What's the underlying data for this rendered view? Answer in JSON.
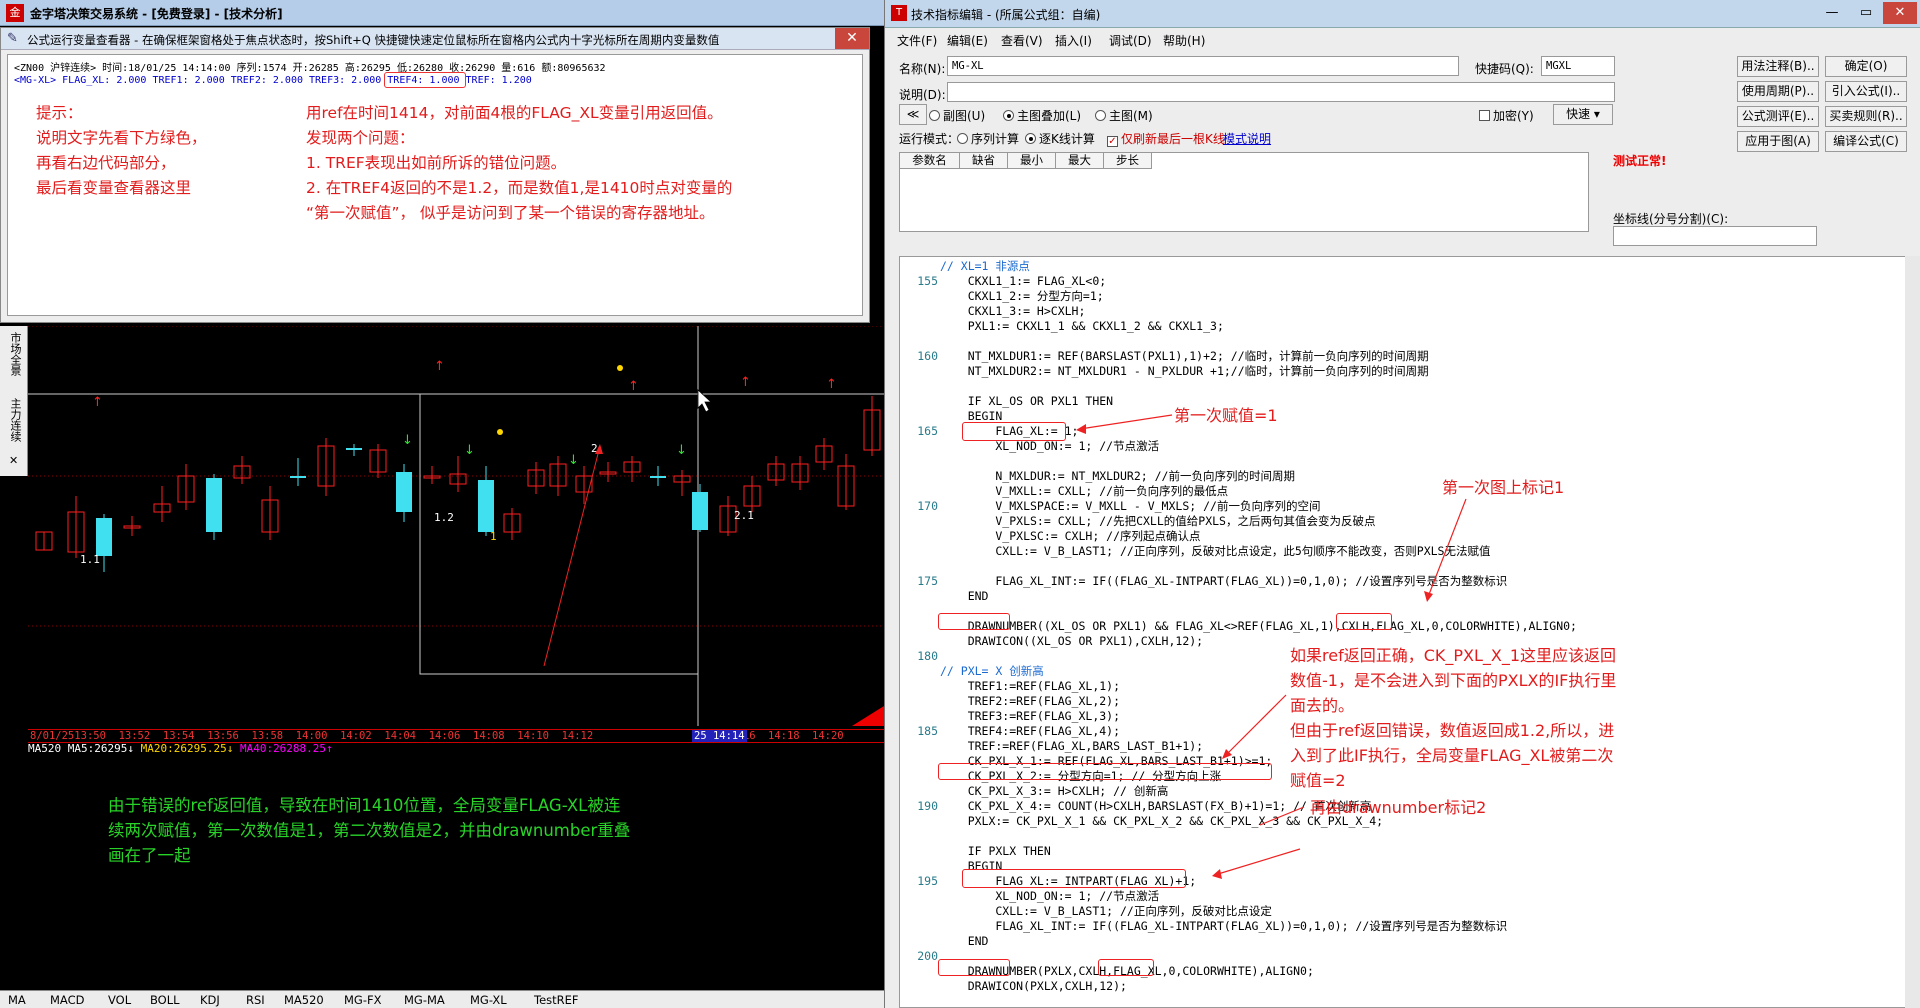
{
  "main_window": {
    "title": "金字塔决策交易系统 - [免费登录] - [技术分析]"
  },
  "viewer": {
    "title": "公式运行变量查看器 - 在确保框架窗格处于焦点状态时，按Shift+Q 快捷键快速定位鼠标所在窗格内公式内十字光标所在周期内变量数值",
    "close": "✕",
    "line1": "<ZN00 沪锌连续> 时间:18/01/25 14:14:00 序列:1574 开:26285 高:26295 低:26280 收:26290 量:616 额:80965632",
    "line2": "<MG-XL> FLAG_XL: 2.000 TREF1: 2.000 TREF2: 2.000 TREF3: 2.000 TREF4: 1.000 TREF: 1.200",
    "hint": [
      "提示：",
      "说明文字先看下方绿色，",
      "再看右边代码部分，",
      "最后看变量查看器这里"
    ],
    "desc": [
      "用ref在时间1414，对前面4根的FLAG_XL变量引用返回值。",
      "发现两个问题：",
      "1.   TREF表现出如前所诉的错位问题。",
      "2.   在TREF4返回的不是1.2，而是数值1,是1410时点对变量的",
      "“第一次赋值”，  似乎是访问到了某一个错误的寄存器地址。"
    ]
  },
  "side_strip": [
    "市场全景",
    "主力连续",
    "✕"
  ],
  "chart": {
    "labels": [
      "1.1",
      "1.2",
      "1",
      "2",
      "2.1"
    ],
    "time_axis": [
      "8/01/25",
      "13:50",
      "13:52",
      "13:54",
      "13:56",
      "13:58",
      "14:00",
      "14:02",
      "14:04",
      "14:06",
      "14:08",
      "14:10",
      "14:12",
      "14:16",
      "14:18",
      "14:20"
    ],
    "current_time": "25 14:14",
    "ma_line": [
      {
        "text": "MA520",
        "color": "#ffffff"
      },
      {
        "text": " MA5:26295↓",
        "color": "#ffffff"
      },
      {
        "text": " MA20:26295.25↓",
        "color": "#ffd700"
      },
      {
        "text": " MA40:26288.25↑",
        "color": "#ff00ff"
      }
    ],
    "note": [
      "由于错误的ref返回值，导致在时间1410位置，全局变量FLAG-XL被连",
      "续两次赋值，第一次数值是1，第二次数值是2，并由drawnumber重叠",
      "画在了一起"
    ]
  },
  "bottom_tabs": [
    "MA",
    "MACD",
    "VOL",
    "BOLL",
    "KDJ",
    "RSI",
    "MA520",
    "MG-FX",
    "MG-MA",
    "MG-XL",
    "TestREF"
  ],
  "editor": {
    "title": "技术指标编辑 - (所属公式组：自编)",
    "menu": [
      "文件(F)",
      "编辑(E)",
      "查看(V)",
      "插入(I)",
      "调试(D)",
      "帮助(H)"
    ],
    "name_label": "名称(N):",
    "name_value": "MG-XL",
    "hotkey_label": "快捷码(Q):",
    "hotkey_value": "MGXL",
    "desc_label": "说明(D):",
    "radio_sub": "副图(U)",
    "radio_main_overlay": "主图叠加(L)",
    "radio_main": "主图(M)",
    "encrypt": "加密(Y)",
    "quick": "快速 ▾",
    "run_mode_label": "运行模式：",
    "run_seq": "序列计算",
    "run_bar": "逐K线计算",
    "only_last": "仅刷新最后一根K线",
    "mode_help": "模式说明",
    "params_headers": [
      "参数名",
      "缺省",
      "最小",
      "最大",
      "步长"
    ],
    "test_ok": "测试正常!",
    "axis_label": "坐标线(分号分割)(C):",
    "buttons": [
      "用法注释(B)..",
      "确定(O)",
      "使用周期(P)..",
      "引入公式(I)..",
      "公式测评(E)..",
      "买卖规则(R)..",
      "应用于图(A)",
      "编译公式(C)"
    ],
    "window_buttons": [
      "—",
      "▭",
      "✕"
    ]
  },
  "code_lines": [
    {
      "n": "",
      "t": "// XL=1 非源点",
      "c": "cm"
    },
    {
      "n": "155",
      "t": "    CKXL1_1:= FLAG_XL<0;"
    },
    {
      "n": "",
      "t": "    CKXL1_2:= 分型方向=1;"
    },
    {
      "n": "",
      "t": "    CKXL1_3:= H>CXLH;"
    },
    {
      "n": "",
      "t": "    PXL1:= CKXL1_1 && CKXL1_2 && CKXL1_3;"
    },
    {
      "n": "",
      "t": ""
    },
    {
      "n": "160",
      "t": "    NT_MXLDUR1:= REF(BARSLAST(PXL1),1)+2; //临时，计算前一负向序列的时间周期"
    },
    {
      "n": "",
      "t": "    NT_MXLDUR2:= NT_MXLDUR1 - N_PXLDUR +1;//临时，计算前一负向序列的时间周期"
    },
    {
      "n": "",
      "t": ""
    },
    {
      "n": "",
      "t": "    IF XL_OS OR PXL1 THEN"
    },
    {
      "n": "",
      "t": "    BEGIN"
    },
    {
      "n": "165",
      "t": "        FLAG_XL:= 1;"
    },
    {
      "n": "",
      "t": "        XL_NOD_ON:= 1; //节点激活"
    },
    {
      "n": "",
      "t": ""
    },
    {
      "n": "",
      "t": "        N_MXLDUR:= NT_MXLDUR2; //前一负向序列的时间周期"
    },
    {
      "n": "",
      "t": "        V_MXLL:= CXLL; //前一负向序列的最低点"
    },
    {
      "n": "170",
      "t": "        V_MXLSPACE:= V_MXLL - V_MXLS; //前一负向序列的空间"
    },
    {
      "n": "",
      "t": "        V_PXLS:= CXLL; //先把CXLL的值给PXLS，之后两句其值会变为反破点"
    },
    {
      "n": "",
      "t": "        V_PXLSC:= CXLH; //序列起点确认点"
    },
    {
      "n": "",
      "t": "        CXLL:= V_B_LAST1; //正向序列，反破对比点设定，此5句顺序不能改变，否则PXLS无法赋值"
    },
    {
      "n": "",
      "t": ""
    },
    {
      "n": "175",
      "t": "        FLAG_XL_INT:= IF((FLAG_XL-INTPART(FLAG_XL))=0,1,0); //设置序列号是否为整数标识"
    },
    {
      "n": "",
      "t": "    END"
    },
    {
      "n": "",
      "t": ""
    },
    {
      "n": "",
      "t": "    DRAWNUMBER((XL_OS OR PXL1) && FLAG_XL<>REF(FLAG_XL,1),CXLH,FLAG_XL,0,COLORWHITE),ALIGN0;"
    },
    {
      "n": "",
      "t": "    DRAWICON((XL_OS OR PXL1),CXLH,12);"
    },
    {
      "n": "180",
      "t": ""
    },
    {
      "n": "",
      "t": "// PXL= X 创新高",
      "c": "cm"
    },
    {
      "n": "",
      "t": "    TREF1:=REF(FLAG_XL,1);"
    },
    {
      "n": "",
      "t": "    TREF2:=REF(FLAG_XL,2);"
    },
    {
      "n": "",
      "t": "    TREF3:=REF(FLAG_XL,3);"
    },
    {
      "n": "185",
      "t": "    TREF4:=REF(FLAG_XL,4);"
    },
    {
      "n": "",
      "t": "    TREF:=REF(FLAG_XL,BARS_LAST_B1+1);"
    },
    {
      "n": "",
      "t": "    CK_PXL_X_1:= REF(FLAG_XL,BARS_LAST_B1+1)>=1;"
    },
    {
      "n": "",
      "t": "    CK_PXL_X_2:= 分型方向=1; // 分型方向上涨"
    },
    {
      "n": "",
      "t": "    CK_PXL_X_3:= H>CXLH; // 创新高"
    },
    {
      "n": "190",
      "t": "    CK_PXL_X_4:= COUNT(H>CXLH,BARSLAST(FX_B)+1)=1; // 首次创新高"
    },
    {
      "n": "",
      "t": "    PXLX:= CK_PXL_X_1 && CK_PXL_X_2 && CK_PXL_X_3 && CK_PXL_X_4;"
    },
    {
      "n": "",
      "t": ""
    },
    {
      "n": "",
      "t": "    IF PXLX THEN"
    },
    {
      "n": "",
      "t": "    BEGIN"
    },
    {
      "n": "195",
      "t": "        FLAG_XL:= INTPART(FLAG_XL)+1;"
    },
    {
      "n": "",
      "t": "        XL_NOD_ON:= 1; //节点激活"
    },
    {
      "n": "",
      "t": "        CXLL:= V_B_LAST1; //正向序列，反破对比点设定"
    },
    {
      "n": "",
      "t": "        FLAG_XL_INT:= IF((FLAG_XL-INTPART(FLAG_XL))=0,1,0); //设置序列号是否为整数标识"
    },
    {
      "n": "",
      "t": "    END"
    },
    {
      "n": "200",
      "t": ""
    },
    {
      "n": "",
      "t": "    DRAWNUMBER(PXLX,CXLH,FLAG_XL,0,COLORWHITE),ALIGN0;"
    },
    {
      "n": "",
      "t": "    DRAWICON(PXLX,CXLH,12);"
    }
  ],
  "annotations": {
    "a1": "第一次赋值=1",
    "a2": "第一次图上标记1",
    "a3": [
      "如果ref返回正确，CK_PXL_X_1这里应该返回",
      "数值-1，是不会进入到下面的PXLX的IF执行里",
      "面去的。",
      "但由于ref返回错误，数值返回成1.2,所以，进",
      "入到了此IF执行，全局变量FLAG_XL被第二次",
      "赋值=2"
    ],
    "a4": "再由drawnumber标记2"
  }
}
